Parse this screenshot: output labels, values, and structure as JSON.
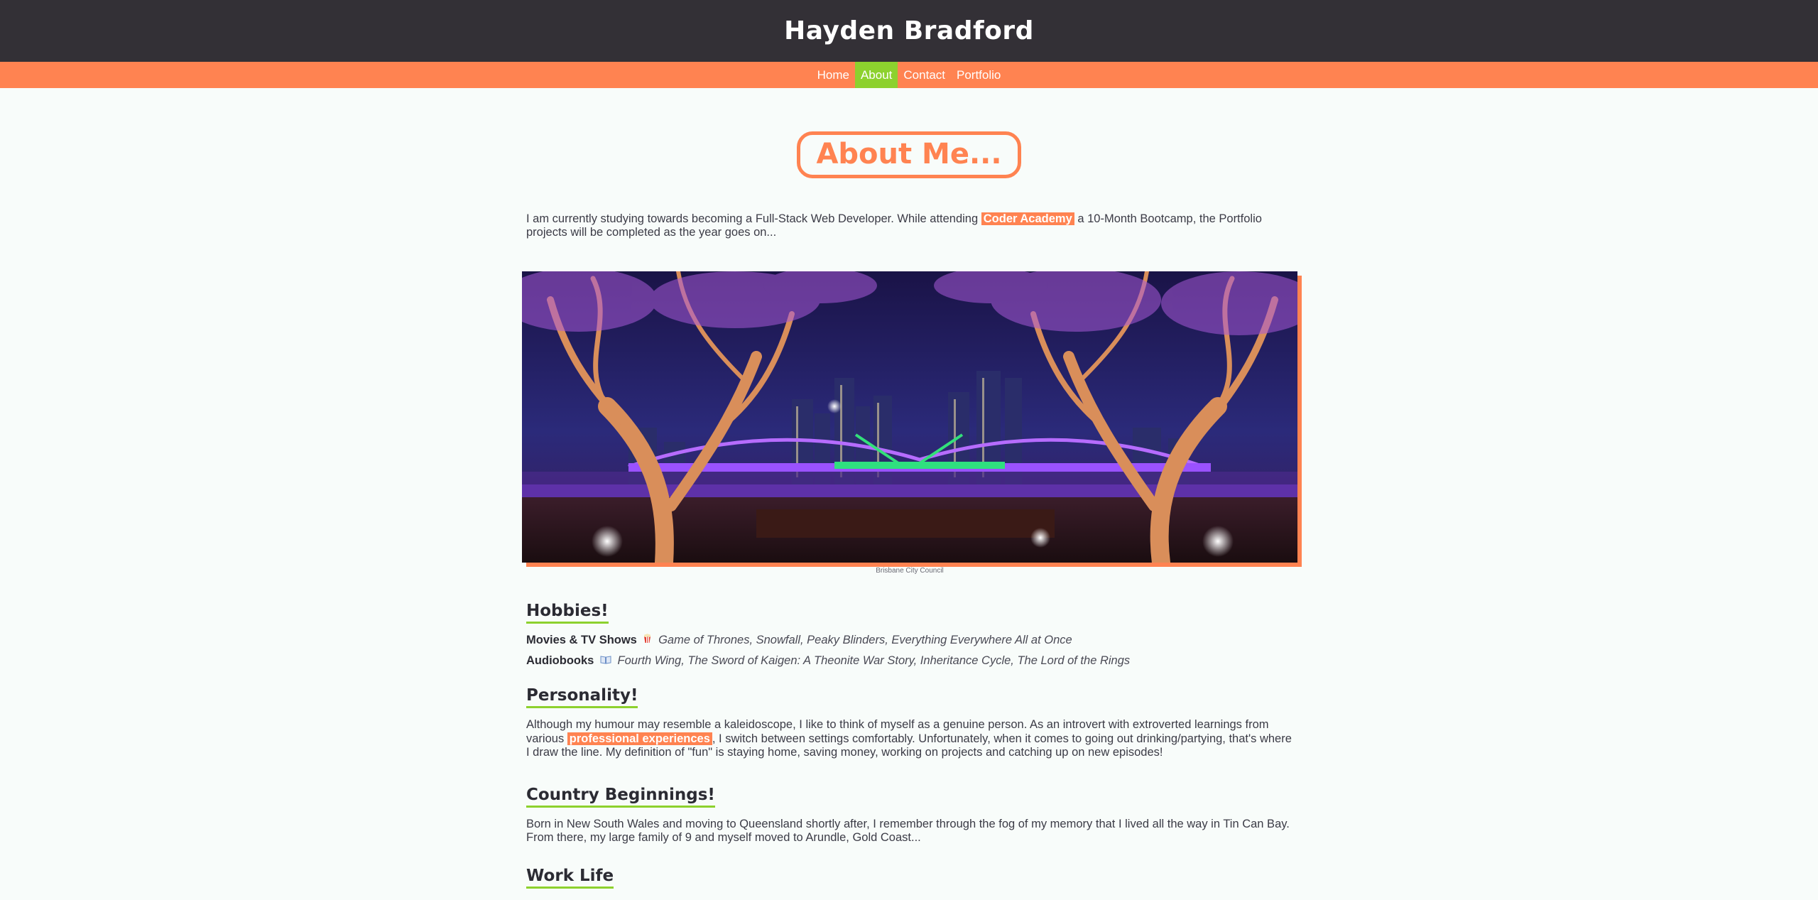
{
  "header": {
    "title": "Hayden Bradford"
  },
  "nav": {
    "items": [
      {
        "label": "Home"
      },
      {
        "label": "About"
      },
      {
        "label": "Contact"
      },
      {
        "label": "Portfolio"
      }
    ]
  },
  "heading": "About Me...",
  "intro": {
    "before": "I am currently studying towards becoming a Full-Stack Web Developer. While attending ",
    "highlight": "Coder Academy",
    "after": " a 10-Month Bootcamp, the Portfolio projects will be completed as the year goes on..."
  },
  "figure": {
    "caption": "Brisbane City Council"
  },
  "hobbies": {
    "heading": "Hobbies!",
    "movies_label": "Movies & TV Shows",
    "movies_icon": "popcorn-icon",
    "movies": "Game of Thrones, Snowfall, Peaky Blinders, Everything Everywhere All at Once",
    "audiobooks_label": "Audiobooks",
    "audiobooks_icon": "book-icon",
    "audiobooks": "Fourth Wing, The Sword of Kaigen: A Theonite War Story, Inheritance Cycle, The Lord of the Rings"
  },
  "personality": {
    "heading": "Personality!",
    "before": "Although my humour may resemble a kaleidoscope, I like to think of myself as a genuine person. As an introvert with extroverted learnings from various ",
    "highlight": "professional experiences",
    "after": ", I switch between settings comfortably. Unfortunately, when it comes to going out drinking/partying, that's where I draw the line. My definition of \"fun\" is staying home, saving money, working on projects and catching up on new episodes!"
  },
  "country": {
    "heading": "Country Beginnings!",
    "text": "Born in New South Wales and moving to Queensland shortly after, I remember through the fog of my memory that I lived all the way in Tin Can Bay. From there, my large family of 9 and myself moved to Arundle, Gold Coast..."
  },
  "worklife": {
    "heading": "Work Life"
  },
  "colors": {
    "header_bg": "#333036",
    "accent": "#ff8351",
    "active": "#8dd12e"
  }
}
